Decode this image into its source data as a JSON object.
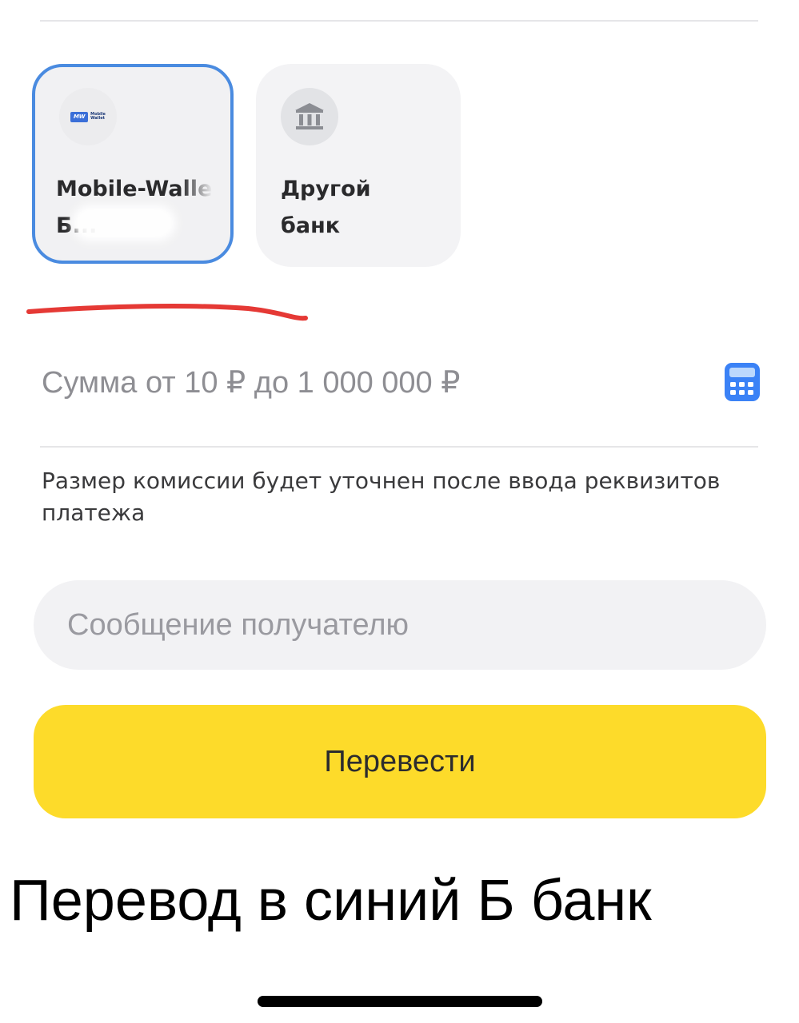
{
  "banks": {
    "selected": {
      "name_line1": "Mobile-Walle",
      "name_line2": "Б...",
      "logo_mark": "MW",
      "logo_text_line1": "Mobile",
      "logo_text_line2": "Wallet",
      "logo_color": "#3b6fd8",
      "selected_border_color": "#4a8be0"
    },
    "other": {
      "name": "Другой банк",
      "icon": "bank-building-icon"
    }
  },
  "annotation": {
    "underline_color": "#e53935"
  },
  "amount": {
    "placeholder": "Сумма от 10 ₽ до 1 000 000 ₽",
    "icon": "calculator-icon",
    "icon_color": "#3b82f6"
  },
  "commission_note": "Размер комиссии будет уточнен после ввода реквизитов платежа",
  "message": {
    "placeholder": "Сообщение получателю"
  },
  "transfer_button": {
    "label": "Перевести",
    "color": "#fddb2a"
  },
  "caption": "Перевод в синий Б банк"
}
